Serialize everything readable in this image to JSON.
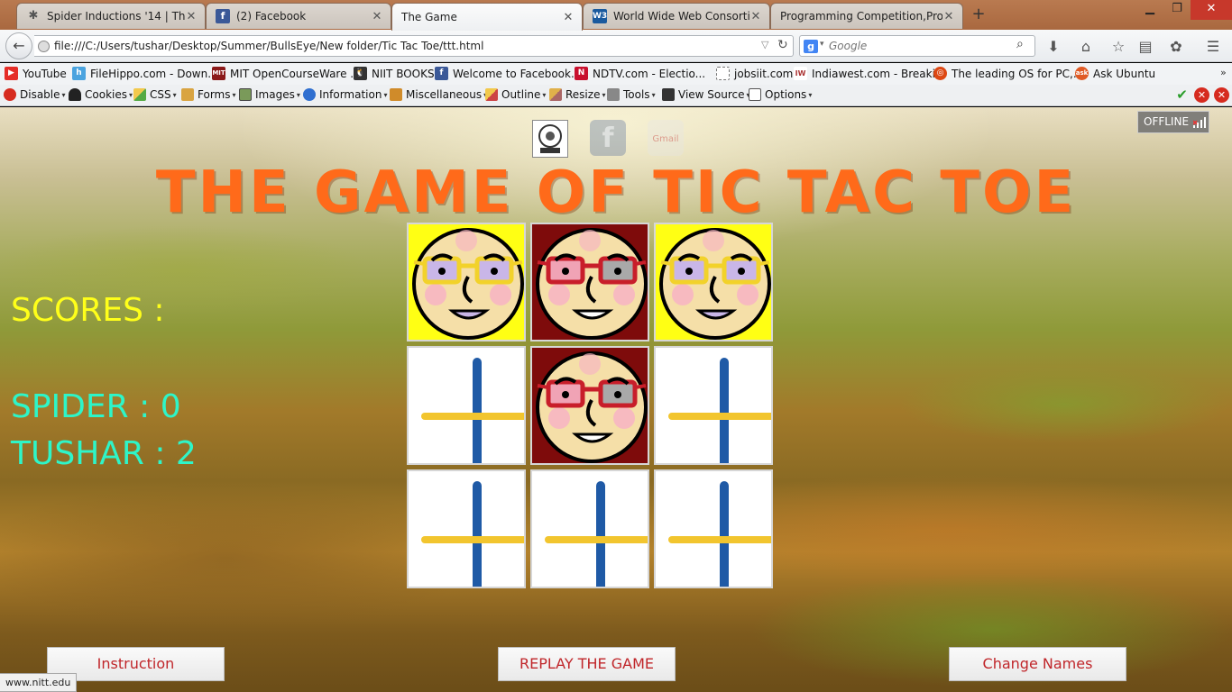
{
  "browser": {
    "tabs": [
      {
        "title": "Spider Inductions '14 | The ...",
        "icon": "spider-icon",
        "active": false
      },
      {
        "title": "(2) Facebook",
        "icon": "facebook-icon",
        "active": false
      },
      {
        "title": "The Game",
        "icon": "",
        "active": true
      },
      {
        "title": "World Wide Web Consorti...",
        "icon": "w3c-icon",
        "active": false
      },
      {
        "title": "Programming Competition,Pro...",
        "icon": "",
        "active": false
      }
    ],
    "url": "file:///C:/Users/tushar/Desktop/Summer/BullsEye/New folder/Tic Tac Toe/ttt.html",
    "search_placeholder": "Google",
    "bookmarks": [
      "YouTube",
      "FileHippo.com - Down...",
      "MIT OpenCourseWare ...",
      "NIIT BOOKS",
      "Welcome to Facebook...",
      "NDTV.com - Electio...",
      "jobsiit.com",
      "Indiawest.com - Breaki...",
      "The leading OS for PC,...",
      "Ask Ubuntu"
    ],
    "devtools": [
      "Disable",
      "Cookies",
      "CSS",
      "Forms",
      "Images",
      "Information",
      "Miscellaneous",
      "Outline",
      "Resize",
      "Tools",
      "View Source",
      "Options"
    ],
    "status_url": "www.nitt.edu"
  },
  "page": {
    "offline_label": "OFFLINE",
    "title": "THE GAME OF TIC TAC TOE",
    "scores_heading": "SCORES :",
    "player1": {
      "name": "SPIDER",
      "score": "0"
    },
    "player2": {
      "name": "TUSHAR",
      "score": "2"
    },
    "board": [
      "p1",
      "p2",
      "p1",
      "empty",
      "p2",
      "empty",
      "empty",
      "empty",
      "empty"
    ],
    "buttons": {
      "instruction": "Instruction",
      "replay": "REPLAY THE GAME",
      "change_names": "Change Names"
    },
    "colors": {
      "title": "#ff6a1a",
      "scores_heading": "#ffff1a",
      "score_lines": "#2ef5c8",
      "p1_cell": "#ffff14",
      "p2_cell": "#7e0b0b",
      "button_text": "#c0262a"
    }
  }
}
